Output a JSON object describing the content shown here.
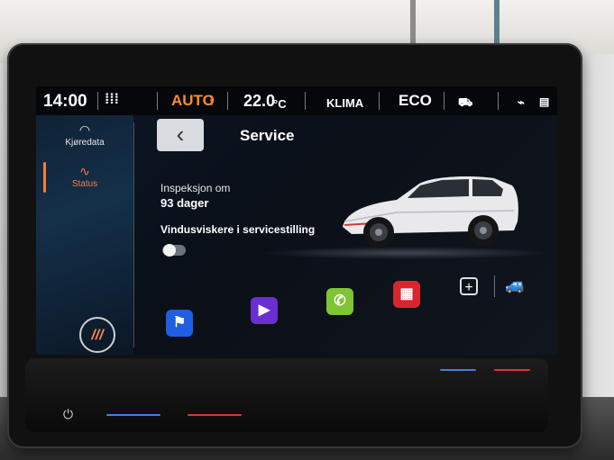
{
  "statusbar": {
    "time": "14:00",
    "mode": "AUTO",
    "temperature": "22.0",
    "temperature_unit": "°C",
    "climate": "KLIMA",
    "drive_mode": "ECO"
  },
  "sidebar": {
    "items": [
      {
        "label": "Kjøredata",
        "icon": "gauge-icon"
      },
      {
        "label": "Status",
        "icon": "pulse-icon",
        "active": true
      }
    ],
    "menu_label": "///"
  },
  "page": {
    "back_label": "‹",
    "title": "Service",
    "inspection_label": "Inspeksjon om",
    "inspection_value": "93 dager",
    "wiper_label": "Vindusviskere i servicestilling",
    "wiper_toggle_on": false
  },
  "appbar": {
    "apps": [
      {
        "icon": "navigation-flag-icon",
        "color": "#1d5fe0"
      },
      {
        "icon": "play-icon",
        "color": "#6a2fd0"
      },
      {
        "icon": "phone-icon",
        "color": "#7ec433"
      },
      {
        "icon": "radio-icon",
        "color": "#d8262e"
      }
    ],
    "plus_label": "+"
  },
  "colors": {
    "accent": "#ff7a3c",
    "statusbar_mode": "#ff8a2a"
  }
}
